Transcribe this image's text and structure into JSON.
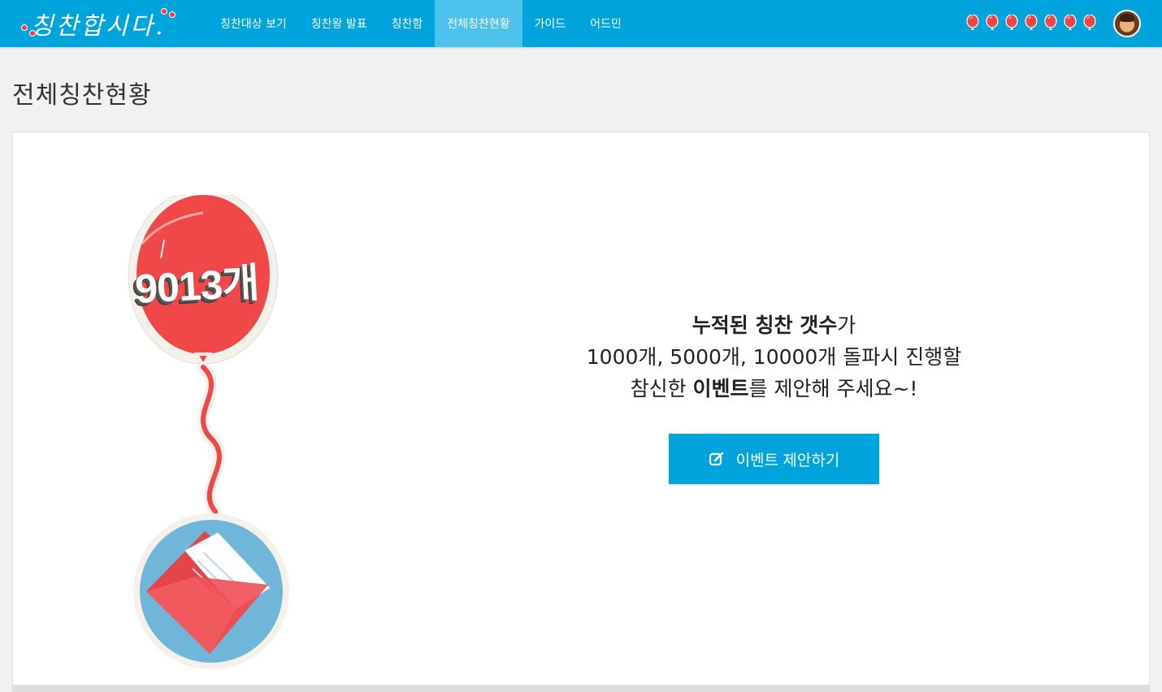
{
  "brand": {
    "name": "칭찬합시다."
  },
  "nav": {
    "items": [
      {
        "label": "칭찬대상 보기",
        "active": false
      },
      {
        "label": "칭찬왕 발표",
        "active": false
      },
      {
        "label": "칭찬함",
        "active": false
      },
      {
        "label": "전체칭찬현황",
        "active": true
      },
      {
        "label": "가이드",
        "active": false
      },
      {
        "label": "어드민",
        "active": false
      }
    ],
    "balloons_count": 7,
    "balloon_color": "#ef4545"
  },
  "page": {
    "title": "전체칭찬현황"
  },
  "counter": {
    "value": "9013개"
  },
  "message": {
    "line1_bold": "누적된 칭찬 갯수",
    "line1_rest": "가",
    "line2": "1000개, 5000개, 10000개 돌파시 진행할",
    "line3_pre": "참신한 ",
    "line3_bold": "이벤트",
    "line3_post": "를 제안해 주세요~!"
  },
  "cta": {
    "label": "이벤트 제안하기",
    "icon": "edit-icon"
  },
  "colors": {
    "primary": "#00a4dd",
    "active_nav": "#4dc2ec",
    "balloon": "#f04848",
    "envelope_bg": "#6fb6d8"
  }
}
